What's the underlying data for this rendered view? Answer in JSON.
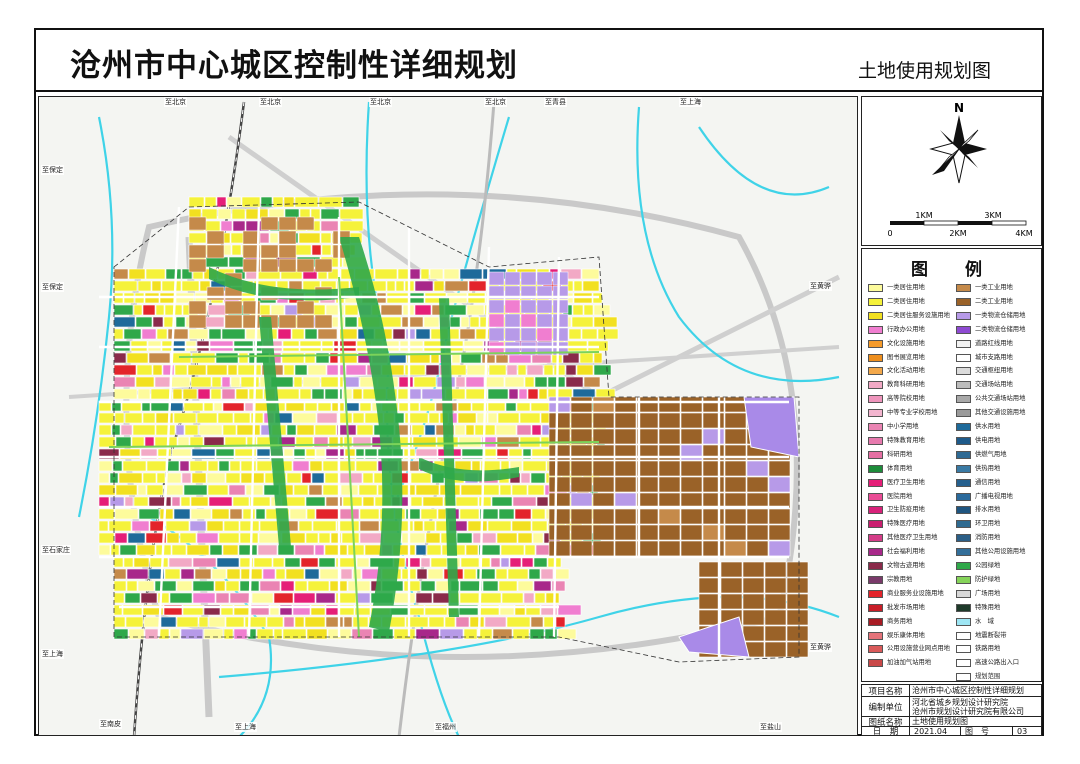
{
  "header": {
    "main_title": "沧州市中心城区控制性详细规划",
    "sub_title": "土地使用规划图"
  },
  "direction_labels": {
    "top": [
      "至北京",
      "至北京",
      "至北京",
      "至北京",
      "至青县",
      "至上海"
    ],
    "left": [
      "至保定",
      "至保定",
      "至石家庄",
      "至上海"
    ],
    "right": [
      "至黄骅",
      "至黄骅"
    ],
    "bottom": [
      "至南皮",
      "至上海",
      "至福州",
      "至盐山"
    ]
  },
  "compass": {
    "north_label": "N",
    "scale_labels": [
      "1KM",
      "3KM"
    ],
    "scale_ticks": [
      "0",
      "2KM",
      "4KM"
    ]
  },
  "legend": {
    "title": "图　例",
    "left_items": [
      {
        "label": "一类居住用地",
        "color": "#fdfb9c"
      },
      {
        "label": "二类居住用地",
        "color": "#f5f23a"
      },
      {
        "label": "二类居住服务设施用地",
        "color": "#f2e020"
      },
      {
        "label": "行政办公用地",
        "color": "#f07ed0"
      },
      {
        "label": "文化设施用地",
        "color": "#f69b2a"
      },
      {
        "label": "图书展览用地",
        "color": "#ed8e1e"
      },
      {
        "label": "文化活动用地",
        "color": "#f3a84a"
      },
      {
        "label": "教育科研用地",
        "color": "#f2a9c5"
      },
      {
        "label": "高等院校用地",
        "color": "#ee95bc"
      },
      {
        "label": "中等专业学校用地",
        "color": "#f3b5cf"
      },
      {
        "label": "中小学用地",
        "color": "#ea84b3"
      },
      {
        "label": "特殊教育用地",
        "color": "#e77aae"
      },
      {
        "label": "科研用地",
        "color": "#e56fa3"
      },
      {
        "label": "体育用地",
        "color": "#1d8c3a"
      },
      {
        "label": "医疗卫生用地",
        "color": "#e51e78"
      },
      {
        "label": "医院用地",
        "color": "#ea4c96"
      },
      {
        "label": "卫生防疫用地",
        "color": "#d8227a"
      },
      {
        "label": "特殊医疗用地",
        "color": "#c91f6f"
      },
      {
        "label": "其他医疗卫生用地",
        "color": "#d43d88"
      },
      {
        "label": "社会福利用地",
        "color": "#a8288a"
      },
      {
        "label": "文物古迹用地",
        "color": "#8a2a4a"
      },
      {
        "label": "宗教用地",
        "color": "#7a3a6a"
      },
      {
        "label": "商业服务业设施用地",
        "color": "#e3242b"
      },
      {
        "label": "批发市场用地",
        "color": "#c81e28"
      },
      {
        "label": "商务用地",
        "color": "#a81b24"
      },
      {
        "label": "娱乐康体用地",
        "color": "#e4737a"
      },
      {
        "label": "公用设施营业网点用地",
        "color": "#d95a5a"
      },
      {
        "label": "加油加气站用地",
        "color": "#c94848"
      }
    ],
    "right_items": [
      {
        "label": "一类工业用地",
        "color": "#c58a4a"
      },
      {
        "label": "二类工业用地",
        "color": "#9a6228"
      },
      {
        "label": "一类物流仓储用地",
        "color": "#b79ae8"
      },
      {
        "label": "二类物流仓储用地",
        "color": "#8e4ad2"
      },
      {
        "label": "道路红线用地",
        "color": "#f2f2f2"
      },
      {
        "label": "城市支路用地",
        "color": "#ffffff"
      },
      {
        "label": "交通枢纽用地",
        "color": "#dcdcdc"
      },
      {
        "label": "交通场站用地",
        "color": "#bcbcbc"
      },
      {
        "label": "公共交通场站用地",
        "color": "#a8a8a8"
      },
      {
        "label": "其他交通设施用地",
        "color": "#9a9a9a"
      },
      {
        "label": "供水用地",
        "color": "#1e6a9a"
      },
      {
        "label": "供电用地",
        "color": "#1e5a8a"
      },
      {
        "label": "供燃气用地",
        "color": "#2e6a94"
      },
      {
        "label": "供热用地",
        "color": "#3a7aa4"
      },
      {
        "label": "通信用地",
        "color": "#25608e"
      },
      {
        "label": "广播电视用地",
        "color": "#2a6a9c"
      },
      {
        "label": "排水用地",
        "color": "#1f5580"
      },
      {
        "label": "环卫用地",
        "color": "#2e6a90"
      },
      {
        "label": "消防用地",
        "color": "#2b5e86"
      },
      {
        "label": "其他公用设施用地",
        "color": "#336f9a"
      },
      {
        "label": "公园绿地",
        "color": "#2fa84a"
      },
      {
        "label": "防护绿地",
        "color": "#86d45a"
      },
      {
        "label": "广场用地",
        "color": "#d8d8d8"
      },
      {
        "label": "特殊用地",
        "color": "#1e3a2a"
      },
      {
        "label": "水　域",
        "color": "#9ee6f4"
      },
      {
        "label": "地震断裂带",
        "color": "#ffffff"
      },
      {
        "label": "铁路用地",
        "color": "#ffffff"
      },
      {
        "label": "高速公路出入口",
        "color": "#ffffff"
      },
      {
        "label": "规划范围",
        "color": "#ffffff"
      }
    ]
  },
  "info": {
    "project_key": "项目名称",
    "project_value": "沧州市中心城区控制性详细规划",
    "unit_key": "编制单位",
    "unit_value_1": "河北省城乡规划设计研究院",
    "unit_value_2": "沧州市规划设计研究院有限公司",
    "drawing_key": "图纸名称",
    "drawing_value": "土地使用规划图",
    "date_key": "日　期",
    "date_value": "2021.04",
    "number_key": "图　号",
    "number_value": "03"
  }
}
